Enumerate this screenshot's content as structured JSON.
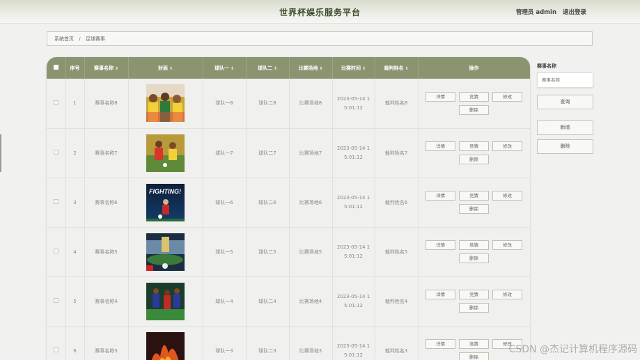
{
  "header": {
    "title": "世界杯娱乐服务平台",
    "user_label": "管理员 admin",
    "logout_label": "退出登录"
  },
  "breadcrumb": {
    "home": "系统首页",
    "separator": "/",
    "current": "足球赛事"
  },
  "table": {
    "columns": [
      "序号",
      "赛事名称",
      "封面",
      "球队一",
      "球队二",
      "比赛场地",
      "比赛时间",
      "裁判姓名",
      "操作"
    ],
    "sortable": [
      false,
      true,
      true,
      true,
      true,
      true,
      true,
      true,
      false
    ],
    "actions": {
      "detail": "详情",
      "bid": "竞猜",
      "edit": "修改",
      "delete": "删除"
    },
    "rows": [
      {
        "index": "1",
        "name": "赛事名称8",
        "team1": "球队一8",
        "team2": "球队二8",
        "venue": "比赛场地8",
        "time1": "2023-05-14 1",
        "time2": "5:01:12",
        "referee": "裁判姓名8",
        "cover": "celebration-photo"
      },
      {
        "index": "2",
        "name": "赛事名称7",
        "team1": "球队一7",
        "team2": "球队二7",
        "venue": "比赛场地7",
        "time1": "2023-05-14 1",
        "time2": "5:01:12",
        "referee": "裁判姓名7",
        "cover": "match-photo"
      },
      {
        "index": "3",
        "name": "赛事名称6",
        "team1": "球队一6",
        "team2": "球队二6",
        "venue": "比赛场地6",
        "time1": "2023-05-14 1",
        "time2": "5:01:12",
        "referee": "裁判姓名6",
        "cover": "fighting-poster",
        "cover_text": "FIGHTING!"
      },
      {
        "index": "4",
        "name": "赛事名称5",
        "team1": "球队一5",
        "team2": "球队二5",
        "venue": "比赛场地5",
        "time1": "2023-05-14 1",
        "time2": "5:01:12",
        "referee": "裁判姓名5",
        "cover": "stadium-photo"
      },
      {
        "index": "5",
        "name": "赛事名称4",
        "team1": "球队一4",
        "team2": "球队二4",
        "venue": "比赛场地4",
        "time1": "2023-05-14 1",
        "time2": "5:01:12",
        "referee": "裁判姓名4",
        "cover": "players-photo"
      },
      {
        "index": "6",
        "name": "赛事名称3",
        "team1": "球队一3",
        "team2": "球队二3",
        "venue": "比赛场地3",
        "time1": "2023-05-14 1",
        "time2": "5:01:12",
        "referee": "裁判姓名3",
        "cover": "fire-photo"
      }
    ]
  },
  "sidebar": {
    "search_label": "赛事名称",
    "search_placeholder": "赛事名称",
    "query_button": "查询",
    "add_button": "新增",
    "delete_button": "删除"
  },
  "watermark": "CSDN @杰记计算机程序源码",
  "colors": {
    "header_bg": "#8a9470",
    "page_bg": "#f1f1ef",
    "title": "#3c4a2a"
  }
}
